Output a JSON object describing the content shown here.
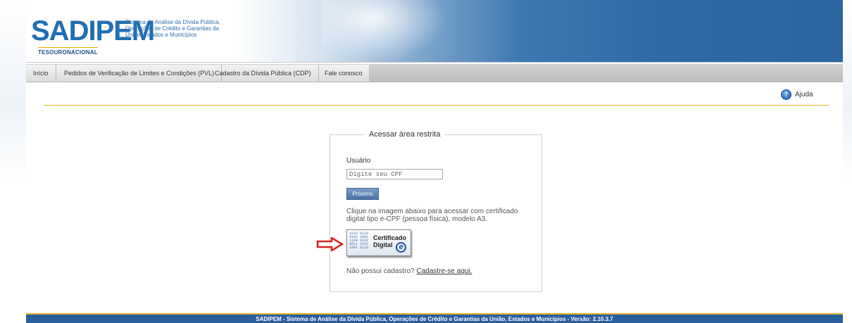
{
  "header": {
    "logo_text": "SADIPEM",
    "subtitle_lines": [
      "Sistema de Análise da Dívida Pública,",
      "Operações de Crédito e Garantias da",
      "União, Estados e Municípios"
    ],
    "tesouro": "TESOURONACIONAL"
  },
  "nav": {
    "items": [
      {
        "label": "Início"
      },
      {
        "label": "Pedidos de Verificação de Limites e Condições (PVL)"
      },
      {
        "label": "Cadastro da Dívida Pública (CDP)"
      },
      {
        "label": "Fale conosco"
      }
    ]
  },
  "help": {
    "icon": "question-icon",
    "label": "Ajuda"
  },
  "login": {
    "legend": "Acessar área restrita",
    "user_label": "Usuário",
    "cpf_placeholder": "Digite seu CPF",
    "cpf_value": "",
    "next_button": "Próximo",
    "info_text": "Clique na imagem abaixo para acessar com certificado digital tipo e-CPF (pessoa física), modelo A3.",
    "certificate": {
      "line1": "Certificado",
      "line2": "Digital",
      "icon": "e-cpf-icon"
    },
    "signup_prompt": "Não possui cadastro?",
    "signup_link": "Cadastre-se aqui."
  },
  "footer": {
    "text": "SADIPEM - Sistema de Análise da Dívida Pública, Operações de Crédito e Garantias da União, Estados e Municípios - Versão: 2.10.3.7"
  },
  "colors": {
    "brand_blue": "#1f6fb2",
    "header_blue": "#2a65a0",
    "gold": "#e2b72a",
    "arrow_red": "#d9231f"
  }
}
